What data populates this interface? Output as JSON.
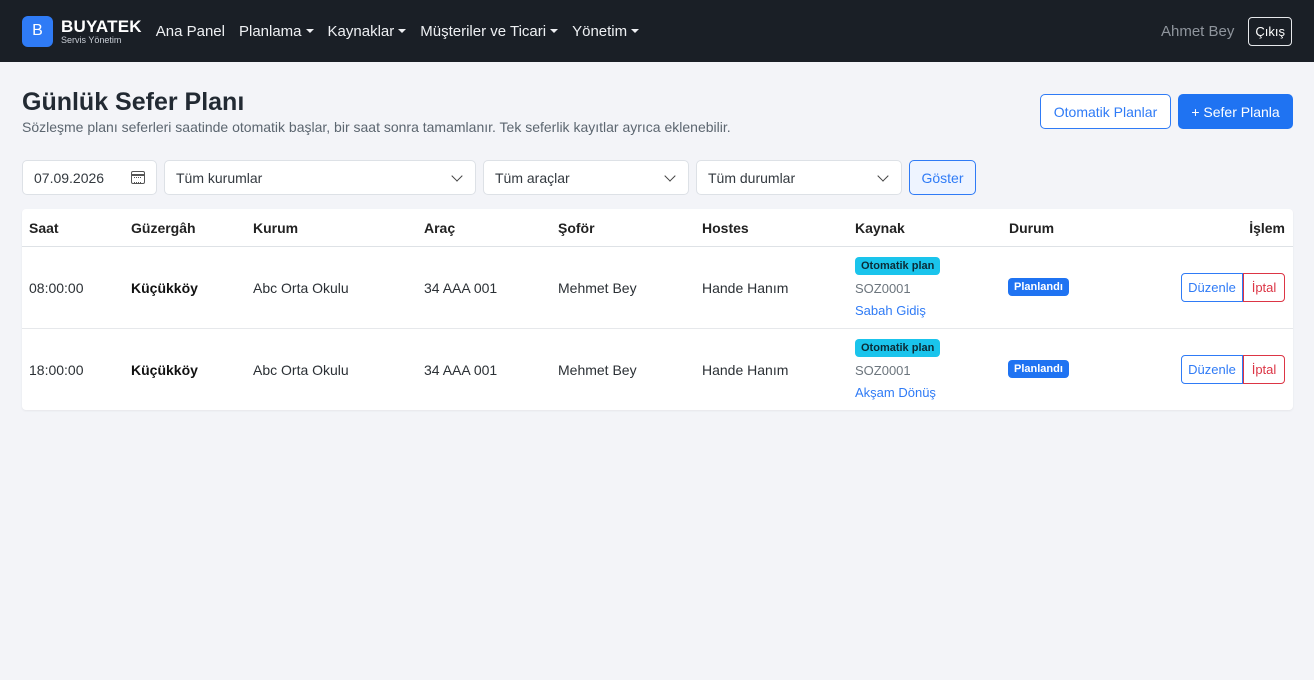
{
  "navbar": {
    "brand_letter": "B",
    "brand_name": "BUYATEK",
    "brand_sub": "Servis Yönetim",
    "links": [
      "Ana Panel",
      "Planlama",
      "Kaynaklar",
      "Müşteriler ve Ticari",
      "Yönetim"
    ],
    "user": "Ahmet Bey",
    "logout": "Çıkış"
  },
  "header": {
    "title": "Günlük Sefer Planı",
    "subtitle": "Sözleşme planı seferleri saatinde otomatik başlar, bir saat sonra tamamlanır. Tek seferlik kayıtlar ayrıca eklenebilir.",
    "auto_plans_button": "Otomatik Planlar",
    "new_trip_button": "+ Sefer Planla"
  },
  "filters": {
    "date": "07.09.2026",
    "institution": "Tüm kurumlar",
    "vehicle": "Tüm araçlar",
    "status": "Tüm durumlar",
    "show_button": "Göster"
  },
  "table": {
    "headers": [
      "Saat",
      "Güzergâh",
      "Kurum",
      "Araç",
      "Şoför",
      "Hostes",
      "Kaynak",
      "Durum",
      "İşlem"
    ],
    "rows": [
      {
        "time": "08:00:00",
        "route": "Küçükköy",
        "institution": "Abc Orta Okulu",
        "vehicle": "34 AAA 001",
        "driver": "Mehmet Bey",
        "hostess": "Hande Hanım",
        "source_badge": "Otomatik plan",
        "source_code": "SOZ0001",
        "source_link": "Sabah Gidiş",
        "status": "Planlandı",
        "edit": "Düzenle",
        "cancel": "İptal"
      },
      {
        "time": "18:00:00",
        "route": "Küçükköy",
        "institution": "Abc Orta Okulu",
        "vehicle": "34 AAA 001",
        "driver": "Mehmet Bey",
        "hostess": "Hande Hanım",
        "source_badge": "Otomatik plan",
        "source_code": "SOZ0001",
        "source_link": "Akşam Dönüş",
        "status": "Planlandı",
        "edit": "Düzenle",
        "cancel": "İptal"
      }
    ]
  },
  "icons": {
    "date_icon": "calendar-icon",
    "select_icon": "chevron-down-icon",
    "menu_caret": "caret-down-icon"
  },
  "colors": {
    "navbar_bg": "#1a1f26",
    "primary": "#1f73f2",
    "auto_badge": "#1ac4ec",
    "danger": "#dc3545"
  }
}
